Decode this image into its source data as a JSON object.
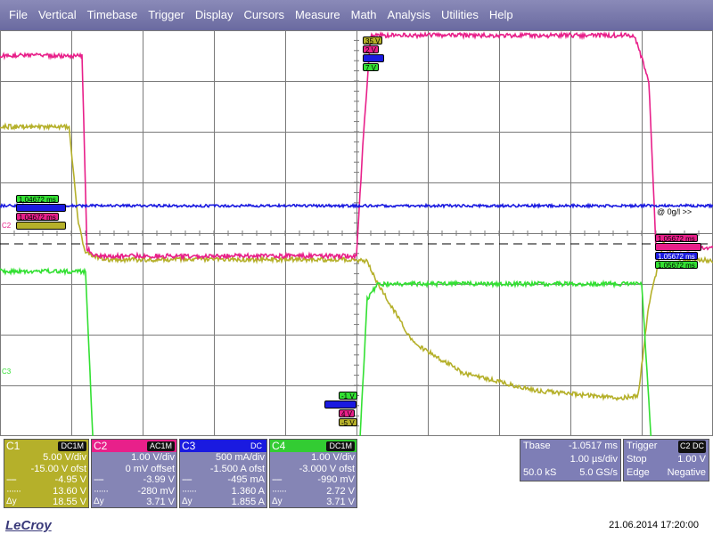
{
  "menu": [
    "File",
    "Vertical",
    "Timebase",
    "Trigger",
    "Display",
    "Cursors",
    "Measure",
    "Math",
    "Analysis",
    "Utilities",
    "Help"
  ],
  "colors": {
    "c1": "#b5b02a",
    "c2": "#e8208a",
    "c3": "#1a1ae0",
    "c4": "#33e033",
    "menu": "#7878ac",
    "grid": "#7a7a7a"
  },
  "markers": {
    "top_cursor": [
      "35 V",
      "2 V",
      "",
      "7 V"
    ],
    "left_cursor": [
      "1.04672 ms",
      "",
      "1.04672 ms",
      ""
    ],
    "c2_label": "C2",
    "c3_label": "C3",
    "right_cursor": [
      "1.05672 ms",
      "",
      "1.05672 ms",
      "1.05672 ms"
    ],
    "bottom_cursor": [
      "-1 V",
      "",
      "4 V",
      "-5 V"
    ],
    "trigger_info": "@ 0g/l >>"
  },
  "channels": [
    {
      "name": "C1",
      "coupling": "DC1M",
      "vdiv": "5.00 V/div",
      "offset": "-15.00 V ofst",
      "cur1": "-4.95 V",
      "cur2": "13.60 V",
      "dy_label": "Δy",
      "dy": "18.55 V"
    },
    {
      "name": "C2",
      "coupling": "AC1M",
      "vdiv": "1.00 V/div",
      "offset": "0 mV offset",
      "cur1": "-3.99 V",
      "cur2": "-280 mV",
      "dy_label": "Δy",
      "dy": "3.71 V"
    },
    {
      "name": "C3",
      "coupling": "DC",
      "vdiv": "500 mA/div",
      "offset": "-1.500 A ofst",
      "cur1": "-495 mA",
      "cur2": "1.360 A",
      "dy_label": "Δy",
      "dy": "1.855 A"
    },
    {
      "name": "C4",
      "coupling": "DC1M",
      "vdiv": "1.00 V/div",
      "offset": "-3.000 V ofst",
      "cur1": "-990 mV",
      "cur2": "2.72 V",
      "dy_label": "Δy",
      "dy": "3.71 V"
    }
  ],
  "timebase": {
    "label": "Tbase",
    "delay": "-1.0517 ms",
    "tdiv": "1.00 µs/div",
    "samples": "50.0 kS",
    "rate": "5.0 GS/s"
  },
  "trigger": {
    "label": "Trigger",
    "source": "C2 DC",
    "mode": "Stop",
    "level": "1.00 V",
    "type": "Edge",
    "slope": "Negative"
  },
  "brand": "LeCroy",
  "timestamp": "21.06.2014 17:20:00",
  "chart_data": {
    "type": "line",
    "x_divisions": 10,
    "y_divisions": 8,
    "series": [
      {
        "name": "C1",
        "points": [
          [
            0,
            25.5
          ],
          [
            0.97,
            25.5
          ],
          [
            1.0,
            23
          ],
          [
            1.1,
            16
          ],
          [
            1.2,
            13
          ],
          [
            1.5,
            12.4
          ],
          [
            5.0,
            12.4
          ],
          [
            5.15,
            12.2
          ],
          [
            5.3,
            10
          ],
          [
            5.8,
            4.2
          ],
          [
            6.5,
            1.2
          ],
          [
            7.5,
            -0.5
          ],
          [
            8.7,
            -1.3
          ],
          [
            8.95,
            -1.0
          ],
          [
            9.1,
            8
          ],
          [
            9.3,
            14
          ],
          [
            9.5,
            12.5
          ],
          [
            10,
            12.3
          ]
        ]
      },
      {
        "name": "C2",
        "points": [
          [
            0,
            3.5
          ],
          [
            1.15,
            3.5
          ],
          [
            1.22,
            -0.3
          ],
          [
            1.35,
            -0.45
          ],
          [
            5.0,
            -0.45
          ],
          [
            5.1,
            2.0
          ],
          [
            5.2,
            3.9
          ],
          [
            5.4,
            3.9
          ],
          [
            8.9,
            3.9
          ],
          [
            9.1,
            3.0
          ],
          [
            9.2,
            -0.3
          ],
          [
            10,
            -0.3
          ]
        ]
      },
      {
        "name": "C3",
        "points": [
          [
            0,
            1.77
          ],
          [
            10,
            1.77
          ]
        ]
      },
      {
        "name": "C4",
        "points": [
          [
            0,
            2.25
          ],
          [
            1.2,
            2.25
          ],
          [
            1.3,
            -1.0
          ],
          [
            1.45,
            -2.7
          ],
          [
            1.6,
            -2.5
          ],
          [
            5.0,
            -2.4
          ],
          [
            5.15,
            1.7
          ],
          [
            5.3,
            2.0
          ],
          [
            9.0,
            2.0
          ],
          [
            9.15,
            -1.5
          ],
          [
            9.3,
            -2.4
          ],
          [
            10,
            -2.5
          ]
        ]
      }
    ]
  }
}
